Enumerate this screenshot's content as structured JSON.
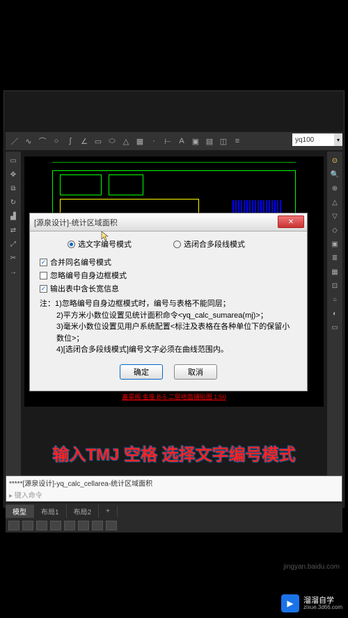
{
  "toolbar": {
    "search_value": "yq100"
  },
  "dialog": {
    "title": "[源泉设计]-统计区域面积",
    "radio1": "选文字编号模式",
    "radio2": "选闭合多段线模式",
    "check1": "合并同名编号模式",
    "check2": "忽略编号自身边框模式",
    "check3": "输出表中含长宽信息",
    "notes_label": "注：",
    "note1": "1)忽略编号自身边框模式时，编号与表格不能同层；",
    "note2": "2)平方米小数位设置见统计面积命令<yq_calc_sumarea(mj)>；",
    "note3": "3)毫米小数位设置见用户系统配置<标注及表格在各种单位下的保留小数位>；",
    "note4": "4)[选闭合多段线模式]编号文字必须在曲线范围内。",
    "ok": "确定",
    "cancel": "取消"
  },
  "drawing": {
    "title_text": "嘉景阁 金座 B-5 二层地面铺贴图  1:50"
  },
  "instruction_text": "输入TMJ 空格 选择文字编号模式",
  "cmdline": {
    "line1": "*****[源泉设计]-yq_calc_cellarea-统计区域面积",
    "line2": "▸ 键入命令"
  },
  "tabs": {
    "t1": "模型",
    "t2": "布局1",
    "t3": "布局2"
  },
  "watermark": {
    "brand": "溜溜自学",
    "url": "zixue.3d66.com",
    "baidu": "jingyan.baidu.com"
  }
}
